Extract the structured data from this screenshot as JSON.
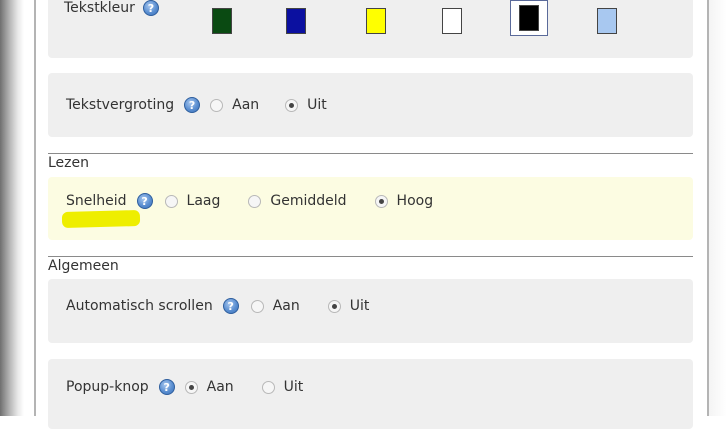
{
  "text_color": {
    "label": "Tekstkleur",
    "help_glyph": "?",
    "swatches": [
      {
        "name": "dark-green",
        "color": "#0a4a12",
        "selected": false
      },
      {
        "name": "blue",
        "color": "#0b10a0",
        "selected": false
      },
      {
        "name": "yellow",
        "color": "#ffff00",
        "selected": false
      },
      {
        "name": "white",
        "color": "#ffffff",
        "selected": false
      },
      {
        "name": "black",
        "color": "#000000",
        "selected": true
      },
      {
        "name": "light-blue",
        "color": "#a8c8f0",
        "selected": false
      }
    ]
  },
  "text_zoom": {
    "label": "Tekstvergroting",
    "help_glyph": "?",
    "options": [
      "Aan",
      "Uit"
    ],
    "selected": "Uit"
  },
  "reading": {
    "section_title": "Lezen",
    "speed": {
      "label": "Snelheid",
      "help_glyph": "?",
      "options": [
        "Laag",
        "Gemiddeld",
        "Hoog"
      ],
      "selected": "Hoog",
      "highlight_color": "#eeee00"
    }
  },
  "general": {
    "section_title": "Algemeen",
    "auto_scroll": {
      "label": "Automatisch scrollen",
      "help_glyph": "?",
      "options": [
        "Aan",
        "Uit"
      ],
      "selected": "Uit"
    },
    "popup_button": {
      "label": "Popup-knop",
      "help_glyph": "?",
      "options": [
        "Aan",
        "Uit"
      ],
      "selected": "Aan"
    }
  }
}
